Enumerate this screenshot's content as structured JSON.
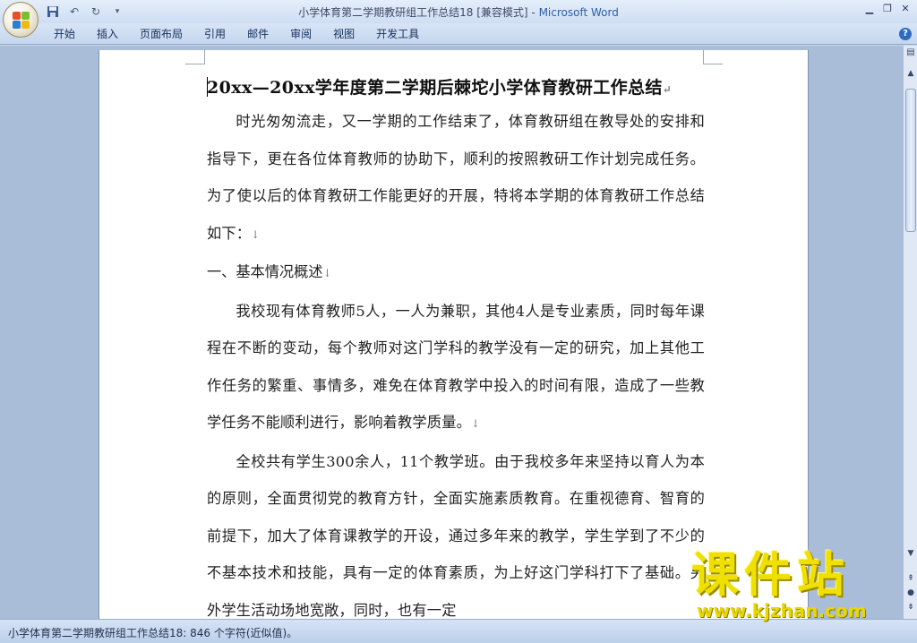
{
  "window": {
    "doc_title": "小学体育第二学期教研组工作总结18 [兼容模式] - ",
    "app_name": "Microsoft Word"
  },
  "ribbon": {
    "tabs": [
      "开始",
      "插入",
      "页面布局",
      "引用",
      "邮件",
      "审阅",
      "视图",
      "开发工具"
    ]
  },
  "document": {
    "title": "20xx—20xx学年度第二学期后棘坨小学体育教研工作总结",
    "paragraphs": [
      "时光匆匆流走，又一学期的工作结束了，体育教研组在教导处的安排和指导下，更在各位体育教师的协助下，顺利的按照教研工作计划完成任务。为了使以后的体育教研工作能更好的开展，特将本学期的体育教研工作总结如下：",
      "一、基本情况概述",
      "我校现有体育教师5人，一人为兼职，其他4人是专业素质，同时每年课程在不断的变动，每个教师对这门学科的教学没有一定的研究，加上其他工作任务的繁重、事情多，难免在体育教学中投入的时间有限，造成了一些教学任务不能顺利进行，影响着教学质量。",
      "全校共有学生300余人，11个教学班。由于我校多年来坚持以育人为本的原则，全面贯彻党的教育方针，全面实施素质教育。在重视德育、智育的前提下，加大了体育课教学的开设，通过多年来的教学，学生学到了不少的不基本技术和技能，具有一定的体育素质，为上好这门学科打下了基础。另外学生活动场地宽敞，同时，也有一定"
    ],
    "paragraph_mark": "↓",
    "title_mark": "↵"
  },
  "status_bar": {
    "text": "小学体育第二学期教研组工作总结18: 846 个字符(近似值)。"
  },
  "watermark": {
    "logo_text": "课件站",
    "url": "www.kjzhan.com"
  },
  "colors": {
    "app_name": "#2e5fa8",
    "watermark": "#f0e000"
  }
}
